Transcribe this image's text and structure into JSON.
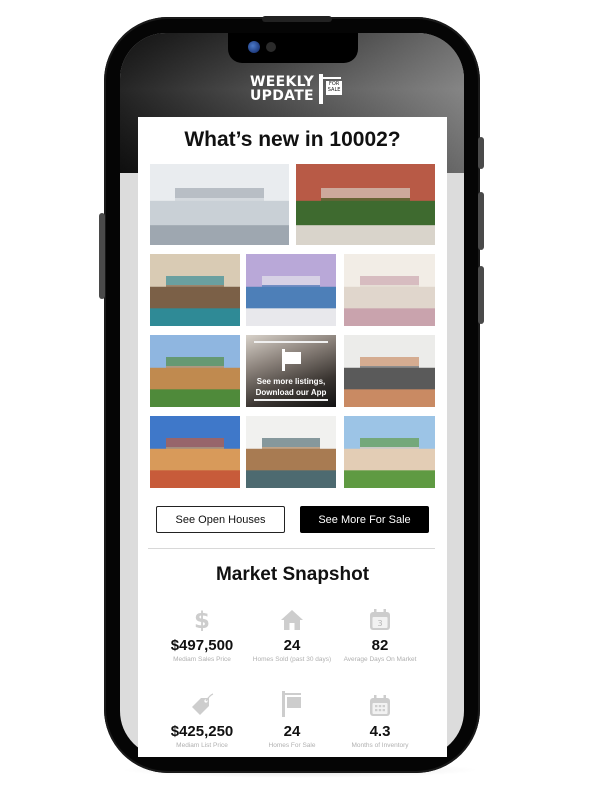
{
  "header": {
    "logo_line1": "WEEKLY",
    "logo_line2": "UPDATE",
    "logo_sign_line1": "FOR",
    "logo_sign_line2": "SALE"
  },
  "main": {
    "title": "What’s new in 10002?",
    "gallery": [
      {
        "name": "loft-living-room-photo",
        "palette": [
          "#e9ecef",
          "#c9d0d6",
          "#9ea7b0"
        ]
      },
      {
        "name": "brownstone-street-photo",
        "palette": [
          "#b85a46",
          "#3e6a2f",
          "#d9d4cb"
        ]
      },
      {
        "name": "loft-kitchen-photo",
        "palette": [
          "#d9cbb4",
          "#7b6047",
          "#2f8a96"
        ]
      },
      {
        "name": "apartment-tower-photo",
        "palette": [
          "#b9a8d8",
          "#4d7fb8",
          "#e8e8ec"
        ]
      },
      {
        "name": "bright-living-room-photo",
        "palette": [
          "#f2ede6",
          "#e0d6cc",
          "#c9a3ad"
        ]
      },
      {
        "name": "suburban-house-photo",
        "palette": [
          "#8fb6e0",
          "#c08a4f",
          "#4f8a3a"
        ]
      },
      {
        "name": "home-office-photo",
        "palette": [
          "#ececea",
          "#5a5a5a",
          "#c98a63"
        ]
      },
      {
        "name": "row-houses-photo",
        "palette": [
          "#3f78c9",
          "#d89a5a",
          "#c75b3a"
        ]
      },
      {
        "name": "modern-kitchen-photo",
        "palette": [
          "#f1f1ef",
          "#a87b52",
          "#4d6a70"
        ]
      },
      {
        "name": "two-story-house-photo",
        "palette": [
          "#9cc4e6",
          "#e3cdb5",
          "#5f9a42"
        ]
      }
    ],
    "app_tile": {
      "line1": "See more listings,",
      "line2": "Download our App"
    },
    "buttons": {
      "open_houses": "See Open Houses",
      "for_sale": "See More For Sale"
    }
  },
  "snapshot": {
    "title": "Market Snapshot",
    "stats": [
      {
        "icon": "dollar-icon",
        "value": "$497,500",
        "label": "Mediam Sales Price"
      },
      {
        "icon": "house-icon",
        "value": "24",
        "label": "Homes Sold (past 30 days)"
      },
      {
        "icon": "calendar-icon",
        "value": "82",
        "label": "Average Days On Market",
        "icon_text": "3"
      },
      {
        "icon": "price-tag-icon",
        "value": "$425,250",
        "label": "Mediam List Price"
      },
      {
        "icon": "for-sale-sign-icon",
        "value": "24",
        "label": "Homes For Sale"
      },
      {
        "icon": "calendar-grid-icon",
        "value": "4.3",
        "label": "Months of Inventory"
      }
    ]
  },
  "colors": {
    "primary": "#000000",
    "icon_gray": "#cdcdcd",
    "label_gray": "#b0b0b0",
    "screen_bezel_gray": "#dcdcdc"
  }
}
